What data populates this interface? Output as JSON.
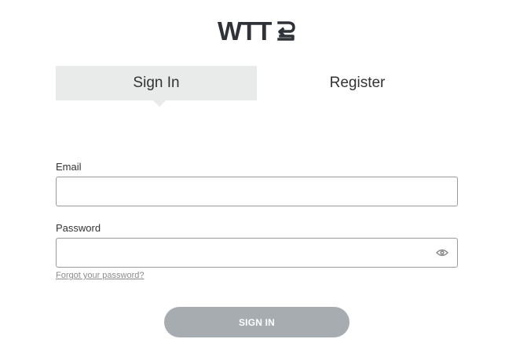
{
  "brand": {
    "logo_text": "WTT",
    "logo_color": "#2f3237"
  },
  "tabs": [
    {
      "label": "Sign In",
      "active": true
    },
    {
      "label": "Register",
      "active": false
    }
  ],
  "form": {
    "email_label": "Email",
    "email_value": "",
    "password_label": "Password",
    "password_value": "",
    "password_toggle_icon": "eye-icon",
    "forgot_link": "Forgot your password?",
    "submit_label": "SIGN IN",
    "submit_enabled": false
  },
  "colors": {
    "tab_active_bg": "#e9eaea",
    "button_disabled_bg": "#a7acb0",
    "input_border": "#9a9a9a",
    "link_color": "#8c8c8c"
  }
}
